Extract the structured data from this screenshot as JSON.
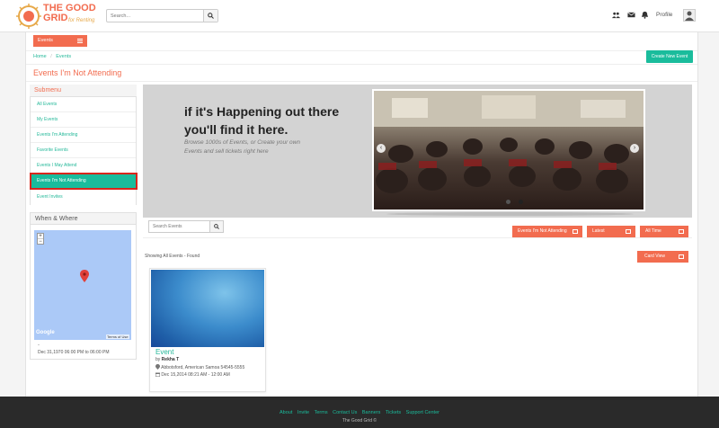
{
  "header": {
    "logo_line1": "THE GOOD",
    "logo_line2": "GRID",
    "logo_tagline": "for Renting",
    "search_placeholder": "Search...",
    "profile_label": "Profile"
  },
  "nav": {
    "events_dropdown_label": "Events"
  },
  "breadcrumb": {
    "home": "Home",
    "separator": "/",
    "current": "Events"
  },
  "create_button_label": "Create New Event",
  "page_title": "Events I'm Not Attending",
  "submenu": {
    "title": "Submenu",
    "items": [
      {
        "label": "All Events"
      },
      {
        "label": "My Events"
      },
      {
        "label": "Events I'm Attending"
      },
      {
        "label": "Favorite Events"
      },
      {
        "label": "Events I May Attend"
      },
      {
        "label": "Events I'm Not Attending"
      },
      {
        "label": "Event Invites"
      }
    ]
  },
  "when_where": {
    "title": "When & Where",
    "zoom_in": "+",
    "zoom_out": "−",
    "map_brand": "Google",
    "map_terms": "Terms of Use",
    "dash": "-",
    "date_range": "Dec 31,1970 06:00 PM to 06:00 PM"
  },
  "banner": {
    "headline_line1": "if it's Happening out there",
    "headline_line2": "you'll find it here.",
    "text_line1": "Browse 1000s of Events, or Create your own",
    "text_line2": "Events and sell tickets right here",
    "prev_arrow": "‹",
    "next_arrow": "›"
  },
  "filters": {
    "search_placeholder": "Search Events",
    "status_label": "Events I'm Not Attending",
    "sort_label": "Latest",
    "time_label": "All Time",
    "view_label": "Card View"
  },
  "showing_text": "Showing All Events - Found",
  "event_card": {
    "title": "Event",
    "by_prefix": "by",
    "author": "Rekha T",
    "location": "Abbotsford, American Samoa 54545-5555",
    "date": "Dec 15,2014 08:21 AM - 12:00 AM"
  },
  "footer": {
    "links": [
      "About",
      "Invite",
      "Terms",
      "Contact Us",
      "Banners",
      "Tickets",
      "Support Center"
    ],
    "copyright": "The Good Grid ©"
  },
  "colors": {
    "brand_orange": "#f26c4f",
    "brand_teal": "#1abc9c",
    "link_teal": "#26b99a",
    "highlight_border": "#d9261c",
    "footer_bg": "#2a2a2a"
  }
}
